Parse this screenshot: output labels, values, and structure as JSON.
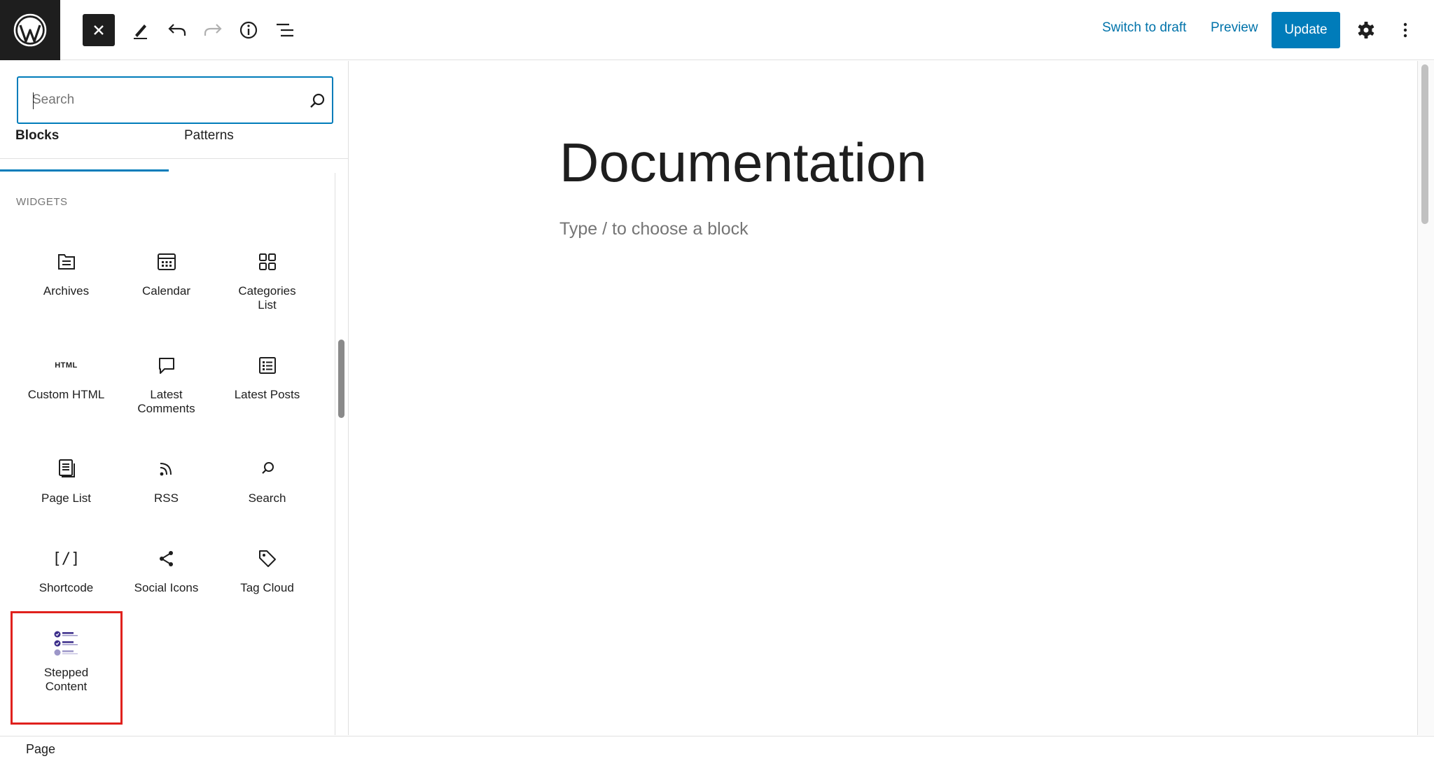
{
  "header": {
    "switch_to_draft": "Switch to draft",
    "preview": "Preview",
    "update": "Update"
  },
  "inserter": {
    "search_placeholder": "Search",
    "tabs": [
      "Blocks",
      "Patterns"
    ],
    "section": "WIDGETS",
    "blocks": [
      {
        "label": "Archives",
        "icon": "archive-icon"
      },
      {
        "label": "Calendar",
        "icon": "calendar-icon"
      },
      {
        "label": "Categories\nList",
        "icon": "categories-icon"
      },
      {
        "label": "Custom HTML",
        "icon": "html-icon",
        "icon_text": "HTML"
      },
      {
        "label": "Latest\nComments",
        "icon": "comment-icon"
      },
      {
        "label": "Latest Posts",
        "icon": "post-list-icon"
      },
      {
        "label": "Page List",
        "icon": "page-list-icon"
      },
      {
        "label": "RSS",
        "icon": "rss-icon"
      },
      {
        "label": "Search",
        "icon": "search-icon"
      },
      {
        "label": "Shortcode",
        "icon": "shortcode-icon",
        "icon_text": "[/]"
      },
      {
        "label": "Social Icons",
        "icon": "share-icon"
      },
      {
        "label": "Tag Cloud",
        "icon": "tag-icon"
      },
      {
        "label": "Stepped\nContent",
        "icon": "stepped-content-icon",
        "highlighted": true
      }
    ]
  },
  "editor": {
    "title": "Documentation",
    "block_placeholder": "Type / to choose a block"
  },
  "footer": {
    "breadcrumb": "Page"
  },
  "colors": {
    "accent": "#007cba",
    "highlight_border": "#e0211d",
    "dark": "#1e1e1e"
  }
}
